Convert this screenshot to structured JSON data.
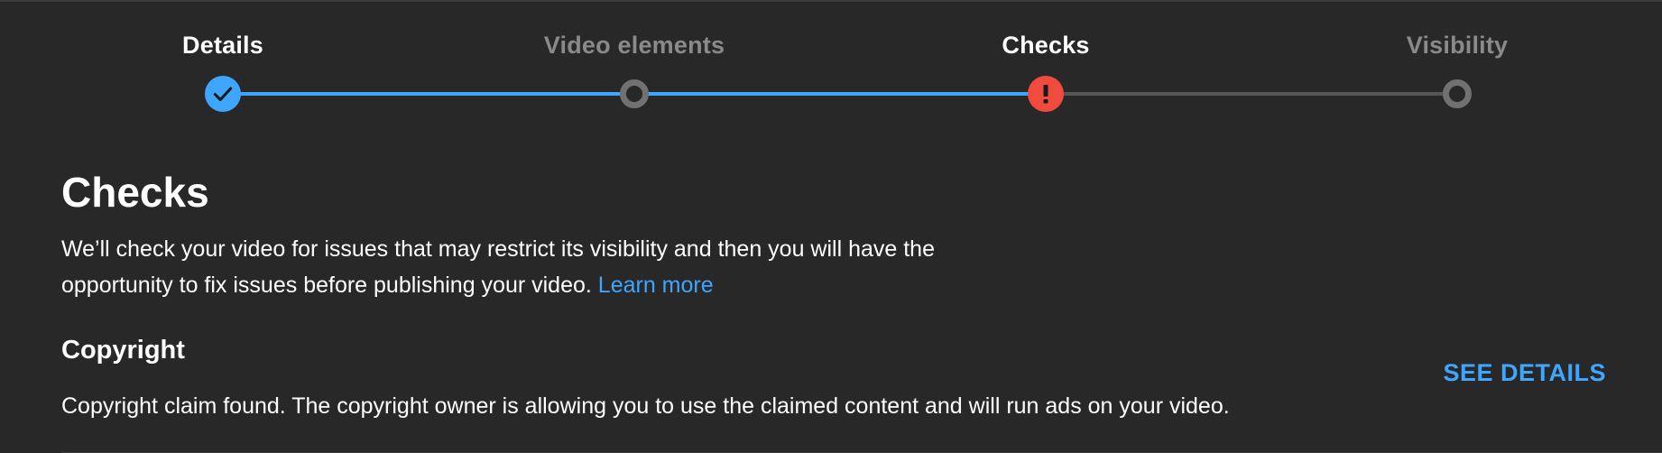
{
  "stepper": {
    "steps": [
      {
        "label": "Details",
        "state": "complete"
      },
      {
        "label": "Video elements",
        "state": "pending"
      },
      {
        "label": "Checks",
        "state": "error"
      },
      {
        "label": "Visibility",
        "state": "pending"
      }
    ],
    "colors": {
      "done_track": "#3ea6ff",
      "todo_track": "#555555",
      "error": "#f04b3e",
      "ring": "#717171"
    },
    "icons": {
      "complete": "check-icon",
      "error": "exclamation-icon"
    }
  },
  "main": {
    "title": "Checks",
    "description": "We’ll check your video for issues that may restrict its visibility and then you will have the opportunity to fix issues before publishing your video.",
    "learn_more": "Learn more"
  },
  "copyright": {
    "title": "Copyright",
    "description": "Copyright claim found. The copyright owner is allowing you to use the claimed content and will run ads on your video.",
    "action": "SEE DETAILS"
  }
}
